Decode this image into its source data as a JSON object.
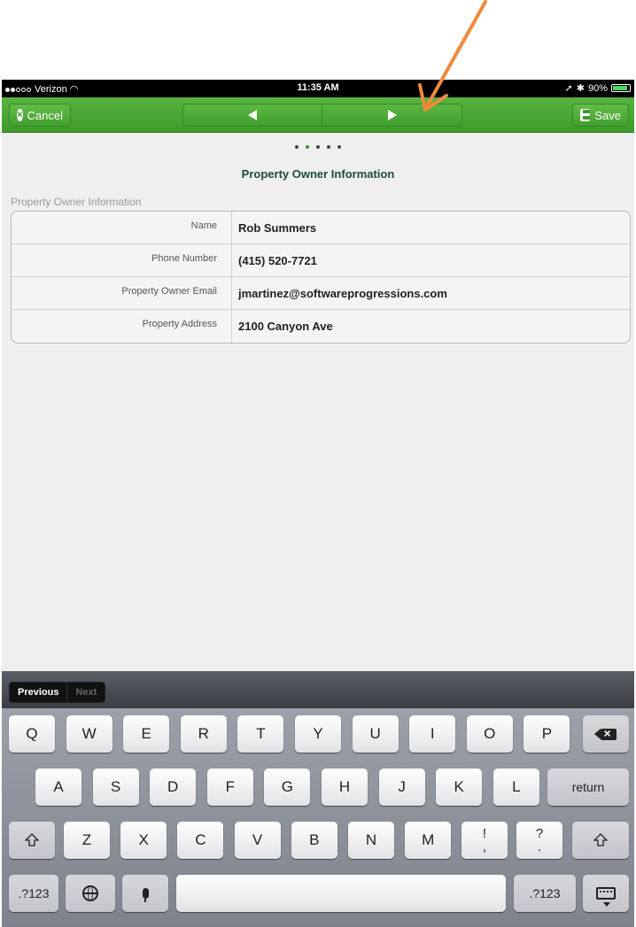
{
  "status_bar": {
    "carrier": "Verizon",
    "time": "11:35 AM",
    "battery": "90%",
    "battery_level": 0.9
  },
  "nav": {
    "cancel_label": "Cancel",
    "save_label": "Save"
  },
  "page": {
    "pages_total": 5,
    "active_page": 2,
    "title": "Property Owner Information"
  },
  "section": {
    "label": "Property Owner Information"
  },
  "form": {
    "rows": [
      {
        "label": "Name",
        "value": "Rob Summers"
      },
      {
        "label": "Phone Number",
        "value": "(415) 520-7721"
      },
      {
        "label": "Property Owner Email",
        "value": "jmartinez@softwareprogressions.com"
      },
      {
        "label": "Property Address",
        "value": "2100 Canyon Ave"
      }
    ]
  },
  "keyboard_accessory": {
    "previous_label": "Previous",
    "next_label": "Next"
  },
  "keyboard": {
    "row1": [
      "Q",
      "W",
      "E",
      "R",
      "T",
      "Y",
      "U",
      "I",
      "O",
      "P"
    ],
    "row2": [
      "A",
      "S",
      "D",
      "F",
      "G",
      "H",
      "J",
      "K",
      "L"
    ],
    "row3": [
      "Z",
      "X",
      "C",
      "V",
      "B",
      "N",
      "M"
    ],
    "punct1": [
      "!",
      ","
    ],
    "punct2": [
      "?",
      "."
    ],
    "return_label": "return",
    "numbers_label": ".?123"
  },
  "colors": {
    "nav_green": "#4caf3a",
    "annotation_arrow": "#f08a3c",
    "title_text": "#1d4a3a"
  }
}
